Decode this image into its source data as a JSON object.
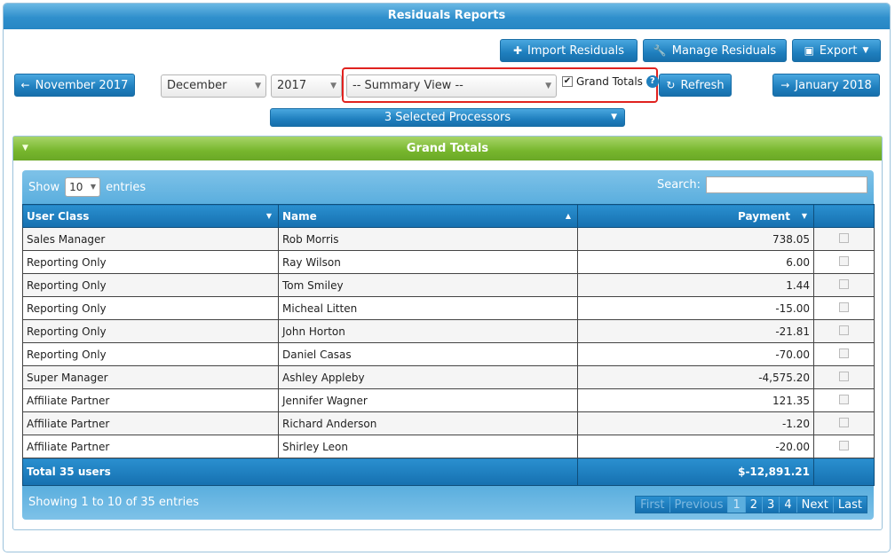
{
  "window": {
    "title": "Residuals Reports"
  },
  "toolbar": {
    "import_label": "Import Residuals",
    "manage_label": "Manage Residuals",
    "export_label": "Export"
  },
  "nav": {
    "prev_label": "November 2017",
    "next_label": "January 2018",
    "month": "December",
    "year": "2017",
    "view": "-- Summary View --",
    "grand_totals_label": "Grand Totals",
    "grand_totals_checked": true,
    "refresh_label": "Refresh"
  },
  "processors": {
    "label": "3 Selected Processors"
  },
  "panel": {
    "title": "Grand Totals"
  },
  "table_controls": {
    "show_label": "Show",
    "entries_label": "entries",
    "page_length": "10",
    "search_label": "Search:"
  },
  "table": {
    "columns": [
      "User Class",
      "Name",
      "Payment"
    ],
    "rows": [
      {
        "user_class": "Sales Manager",
        "name": "Rob Morris",
        "payment": "738.05"
      },
      {
        "user_class": "Reporting Only",
        "name": "Ray Wilson",
        "payment": "6.00"
      },
      {
        "user_class": "Reporting Only",
        "name": "Tom Smiley",
        "payment": "1.44"
      },
      {
        "user_class": "Reporting Only",
        "name": "Micheal Litten",
        "payment": "-15.00"
      },
      {
        "user_class": "Reporting Only",
        "name": "John Horton",
        "payment": "-21.81"
      },
      {
        "user_class": "Reporting Only",
        "name": "Daniel Casas",
        "payment": "-70.00"
      },
      {
        "user_class": "Super Manager",
        "name": "Ashley Appleby",
        "payment": "-4,575.20"
      },
      {
        "user_class": "Affiliate Partner",
        "name": "Jennifer Wagner",
        "payment": "121.35"
      },
      {
        "user_class": "Affiliate Partner",
        "name": "Richard Anderson",
        "payment": "-1.20"
      },
      {
        "user_class": "Affiliate Partner",
        "name": "Shirley Leon",
        "payment": "-20.00"
      }
    ],
    "footer": {
      "label": "Total 35 users",
      "total": "$-12,891.21"
    }
  },
  "pagination": {
    "info": "Showing 1 to 10 of 35 entries",
    "first": "First",
    "previous": "Previous",
    "pages": [
      "1",
      "2",
      "3",
      "4"
    ],
    "next": "Next",
    "last": "Last"
  }
}
